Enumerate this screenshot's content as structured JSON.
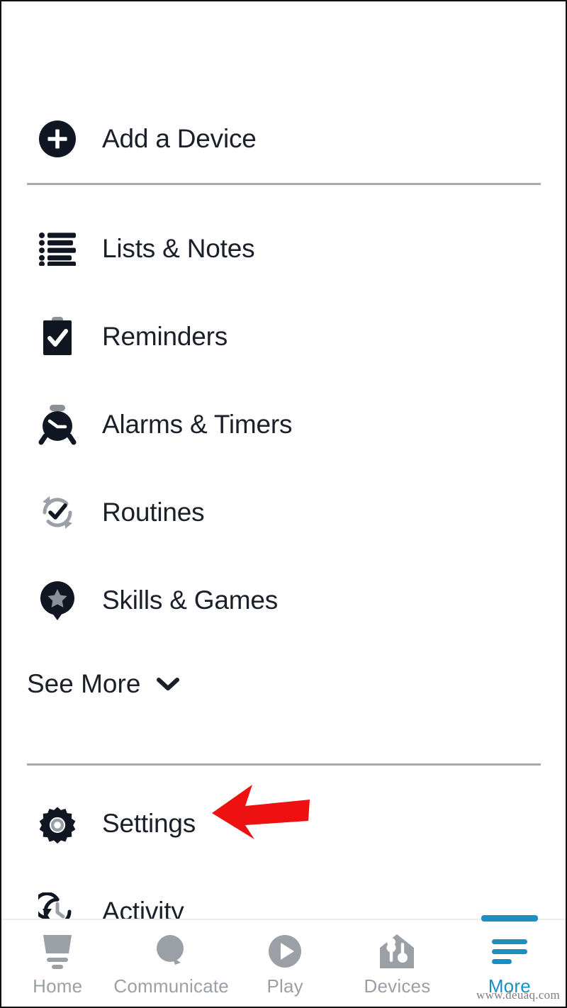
{
  "app": {
    "accent_color": "#1b8ec2",
    "text_color": "#1a1f29",
    "muted_color": "#9aa0a6",
    "divider_color": "#a9a9ae",
    "arrow_color": "#ee1111"
  },
  "menu": {
    "add_device": {
      "label": "Add a Device",
      "icon": "plus-circle-icon"
    },
    "items": [
      {
        "label": "Lists & Notes",
        "icon": "bulleted-list-icon"
      },
      {
        "label": "Reminders",
        "icon": "clipboard-check-icon"
      },
      {
        "label": "Alarms & Timers",
        "icon": "alarm-clock-icon"
      },
      {
        "label": "Routines",
        "icon": "refresh-check-icon"
      },
      {
        "label": "Skills & Games",
        "icon": "star-pin-icon"
      }
    ],
    "see_more": {
      "label": "See More",
      "icon": "chevron-down-icon"
    },
    "footer_items": [
      {
        "label": "Settings",
        "icon": "gear-icon"
      },
      {
        "label": "Activity",
        "icon": "clock-history-icon"
      }
    ]
  },
  "annotation": {
    "arrow": {
      "icon": "left-arrow-annotation",
      "points_to": "Settings",
      "color": "#ee1111"
    }
  },
  "bottom_nav": {
    "items": [
      {
        "label": "Home",
        "icon": "echo-speaker-icon",
        "active": false
      },
      {
        "label": "Communicate",
        "icon": "speech-bubble-icon",
        "active": false
      },
      {
        "label": "Play",
        "icon": "play-circle-icon",
        "active": false
      },
      {
        "label": "Devices",
        "icon": "house-devices-icon",
        "active": false
      },
      {
        "label": "More",
        "icon": "hamburger-menu-icon",
        "active": true
      }
    ]
  },
  "watermark": {
    "text": "www.deuaq.com"
  }
}
